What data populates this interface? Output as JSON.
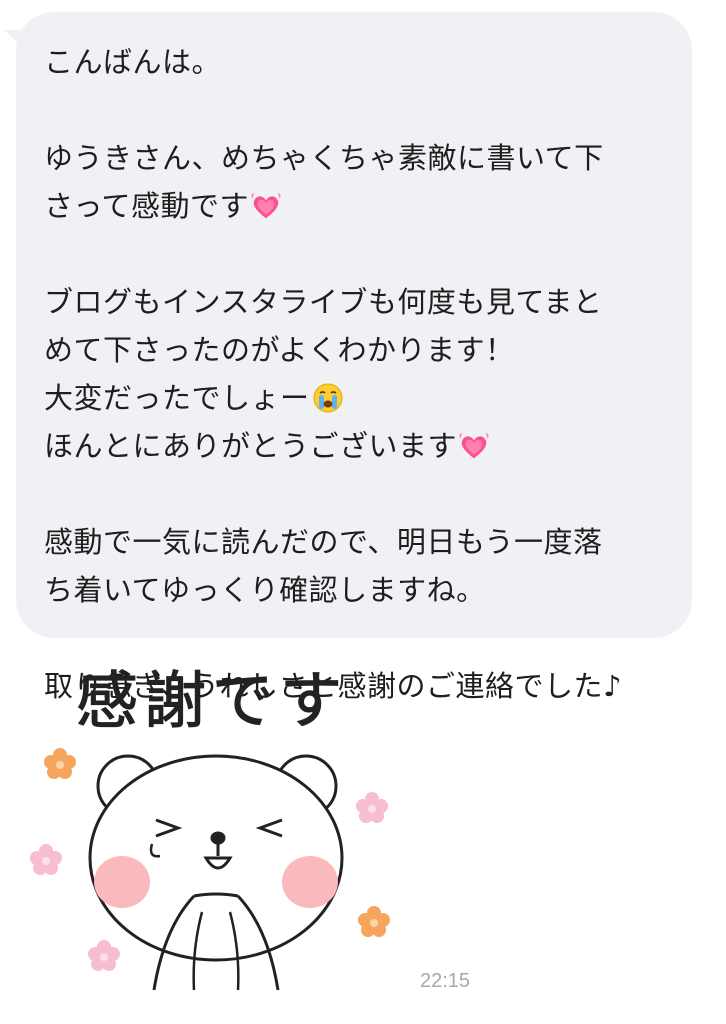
{
  "message": {
    "lines": [
      {
        "text": "こんばんは。",
        "emoji": ""
      },
      {
        "text": "",
        "emoji": ""
      },
      {
        "text": "ゆうきさん、めちゃくちゃ素敵に書いて下",
        "emoji": ""
      },
      {
        "text": "さって感動です",
        "emoji": "heart-icon"
      },
      {
        "text": "",
        "emoji": ""
      },
      {
        "text": "ブログもインスタライブも何度も見てまと",
        "emoji": ""
      },
      {
        "text": "めて下さったのがよくわかります！",
        "emoji": ""
      },
      {
        "text": "大変だったでしょー",
        "emoji": "crying-face-icon"
      },
      {
        "text": "ほんとにありがとうございます",
        "emoji": "heart-icon"
      },
      {
        "text": "",
        "emoji": ""
      },
      {
        "text": "感動で一気に読んだので、明日もう一度落",
        "emoji": ""
      },
      {
        "text": "ち着いてゆっくり確認しますね。",
        "emoji": ""
      },
      {
        "text": "",
        "emoji": ""
      },
      {
        "text": "取り急ぎ、うれしさと感謝のご連絡でした♪",
        "emoji": ""
      }
    ]
  },
  "sticker": {
    "caption": "感謝です",
    "icon": "bear-sticker-icon"
  },
  "timestamp": "22:15",
  "colors": {
    "bubble": "#f0f1f4",
    "text": "#1e1e1e",
    "timestamp": "#a9a9a9",
    "heart": "#ff4f93",
    "blush": "#f9b9bd",
    "flower_pink": "#f7bdd0",
    "flower_orange": "#f5a55c"
  }
}
